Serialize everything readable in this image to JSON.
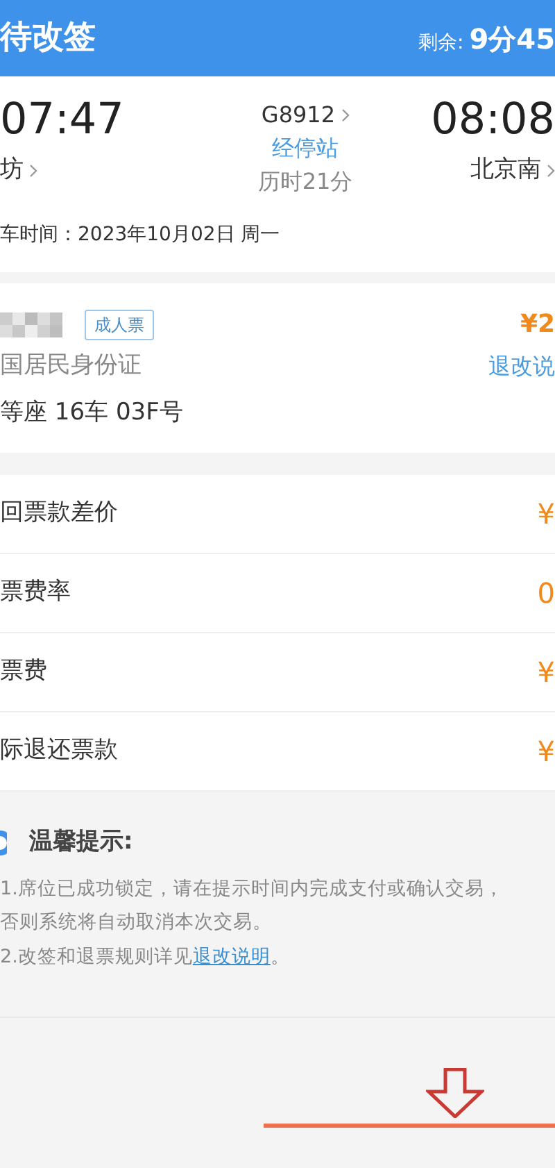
{
  "header": {
    "title": "待改签",
    "countdown_label": "剩余:",
    "countdown_value": "9分45"
  },
  "trip": {
    "depart_time": "07:47",
    "depart_station": "坊",
    "train_no": "G8912",
    "stops_link": "经停站",
    "duration": "历时21分",
    "arrive_time": "08:08",
    "arrive_station": "北京南",
    "date": "车时间：2023年10月02日 周一"
  },
  "passenger": {
    "ticket_type": "成人票",
    "id_type": "国居民身份证",
    "seat": "等座 16车 03F号",
    "price": "¥2",
    "rules_link": "退改说"
  },
  "fees": [
    {
      "label": "回票款差价",
      "value": "¥"
    },
    {
      "label": "票费率",
      "value": "0"
    },
    {
      "label": "票费",
      "value": "¥"
    },
    {
      "label": "际退还票款",
      "value": "¥"
    }
  ],
  "notice": {
    "title": "温馨提示:",
    "lines": [
      "1.席位已成功锁定，请在提示时间内完成支付或确认交易，否则系统将自动取消本次交易。"
    ],
    "line2_prefix": "2.改签和退票规则详见",
    "line2_link": "退改说明",
    "line2_suffix": "。"
  }
}
